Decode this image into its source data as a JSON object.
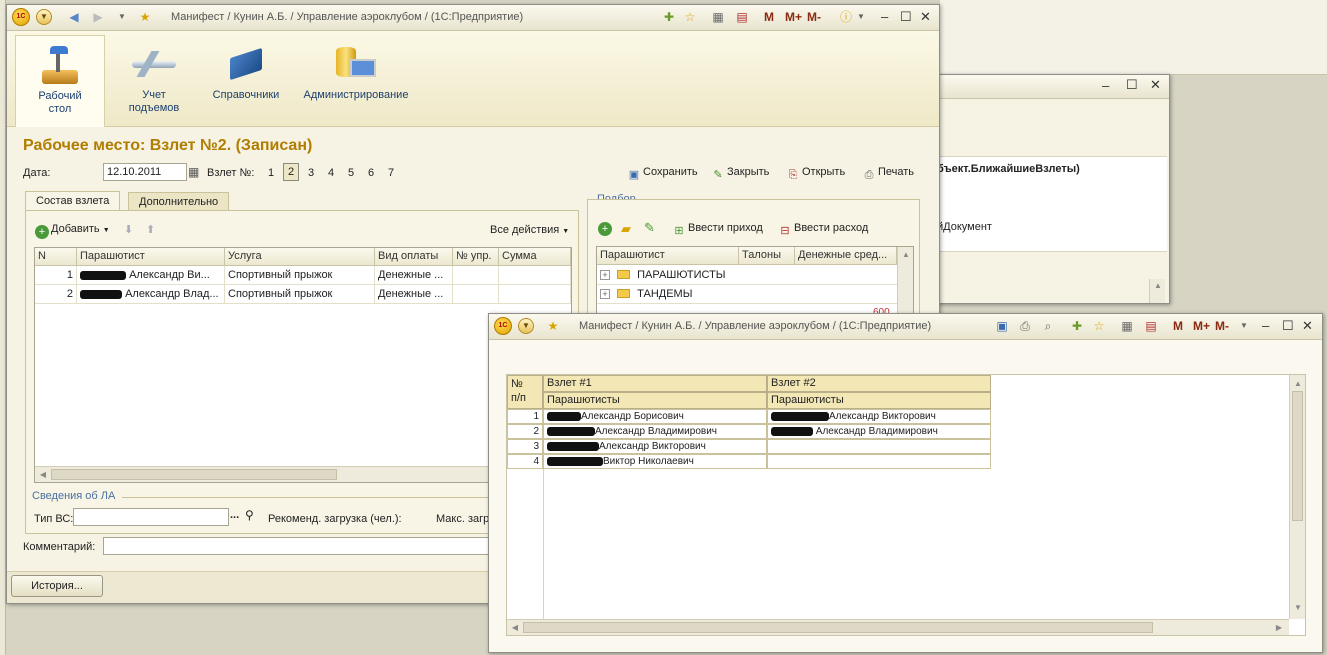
{
  "main_window": {
    "title": "Манифест / Кунин А.Б. / Управление аэроклубом / (1С:Предприятие)",
    "sections": [
      {
        "label_line1": "Рабочий",
        "label_line2": "стол",
        "icon": "desk-lamp-icon"
      },
      {
        "label_line1": "Учет",
        "label_line2": "подъемов",
        "icon": "airplane-icon"
      },
      {
        "label_line1": "Справочники",
        "label_line2": "",
        "icon": "book-icon"
      },
      {
        "label_line1": "Администрирование",
        "label_line2": "",
        "icon": "database-monitor-icon"
      }
    ],
    "form_title": "Рабочее место: Взлет №2. (Записан)",
    "date_label": "Дата:",
    "date_value": "12.10.2011",
    "flight_label": "Взлет №:",
    "flight_numbers": [
      "1",
      "2",
      "3",
      "4",
      "5",
      "6",
      "7"
    ],
    "selected_flight": "2",
    "actions": {
      "save": "Сохранить",
      "close": "Закрыть",
      "open": "Открыть",
      "print": "Печать"
    },
    "tabs": [
      "Состав взлета",
      "Дополнительно"
    ],
    "add_button": "Добавить",
    "all_actions": "Все действия",
    "table": {
      "columns": [
        "N",
        "Парашютист",
        "Услуга",
        "Вид оплаты",
        "№ упр.",
        "Сумма"
      ],
      "rows": [
        {
          "n": "1",
          "name": "Александр Ви...",
          "service": "Спортивный прыжок",
          "payment": "Денежные ...",
          "upr": "",
          "sum": ""
        },
        {
          "n": "2",
          "name": "Александр Влад...",
          "service": "Спортивный прыжок",
          "payment": "Денежные ...",
          "upr": "",
          "sum": ""
        }
      ]
    },
    "aircraft_group": "Сведения об ЛА",
    "aircraft_type_label": "Тип ВС:",
    "recommended_load_label": "Рекоменд. загрузка (чел.):",
    "max_load_label": "Макс. загр",
    "comment_label": "Комментарий:",
    "history_button": "История...",
    "selection": {
      "group_label": "Подбор",
      "income_button": "Ввести приход",
      "expense_button": "Ввести расход",
      "columns": [
        "Парашютист",
        "Талоны",
        "Денежные сред..."
      ],
      "rows": [
        "ПАРАШЮТИСТЫ",
        "ТАНДЕМЫ"
      ],
      "partial_value": "600"
    }
  },
  "background_window": {
    "text1": "бъект.БлижайшиеВзлеты)",
    "text2": "йДокумент"
  },
  "report_window": {
    "title": "Манифест / Кунин А.Б. / Управление аэроклубом / (1С:Предприятие)",
    "header_num_line1": "№",
    "header_num_line2": "п/п",
    "flights": [
      "Взлет #1",
      "Взлет #2"
    ],
    "subheader": "Парашютисты",
    "rows": [
      {
        "n": "1",
        "f1": "Александр Борисович",
        "f2": "Александр Викторович"
      },
      {
        "n": "2",
        "f1": "Александр Владимирович",
        "f2": "Александр Владимирович"
      },
      {
        "n": "3",
        "f1": "Александр Викторович",
        "f2": ""
      },
      {
        "n": "4",
        "f1": "Виктор Николаевич",
        "f2": ""
      }
    ]
  },
  "toolbar_labels": {
    "m": "M",
    "mplus": "M+",
    "mminus": "M-"
  },
  "colors": {
    "accent_title": "#b07d00",
    "link_blue": "#1c3f6e",
    "header_bg": "#f3e7b6"
  }
}
